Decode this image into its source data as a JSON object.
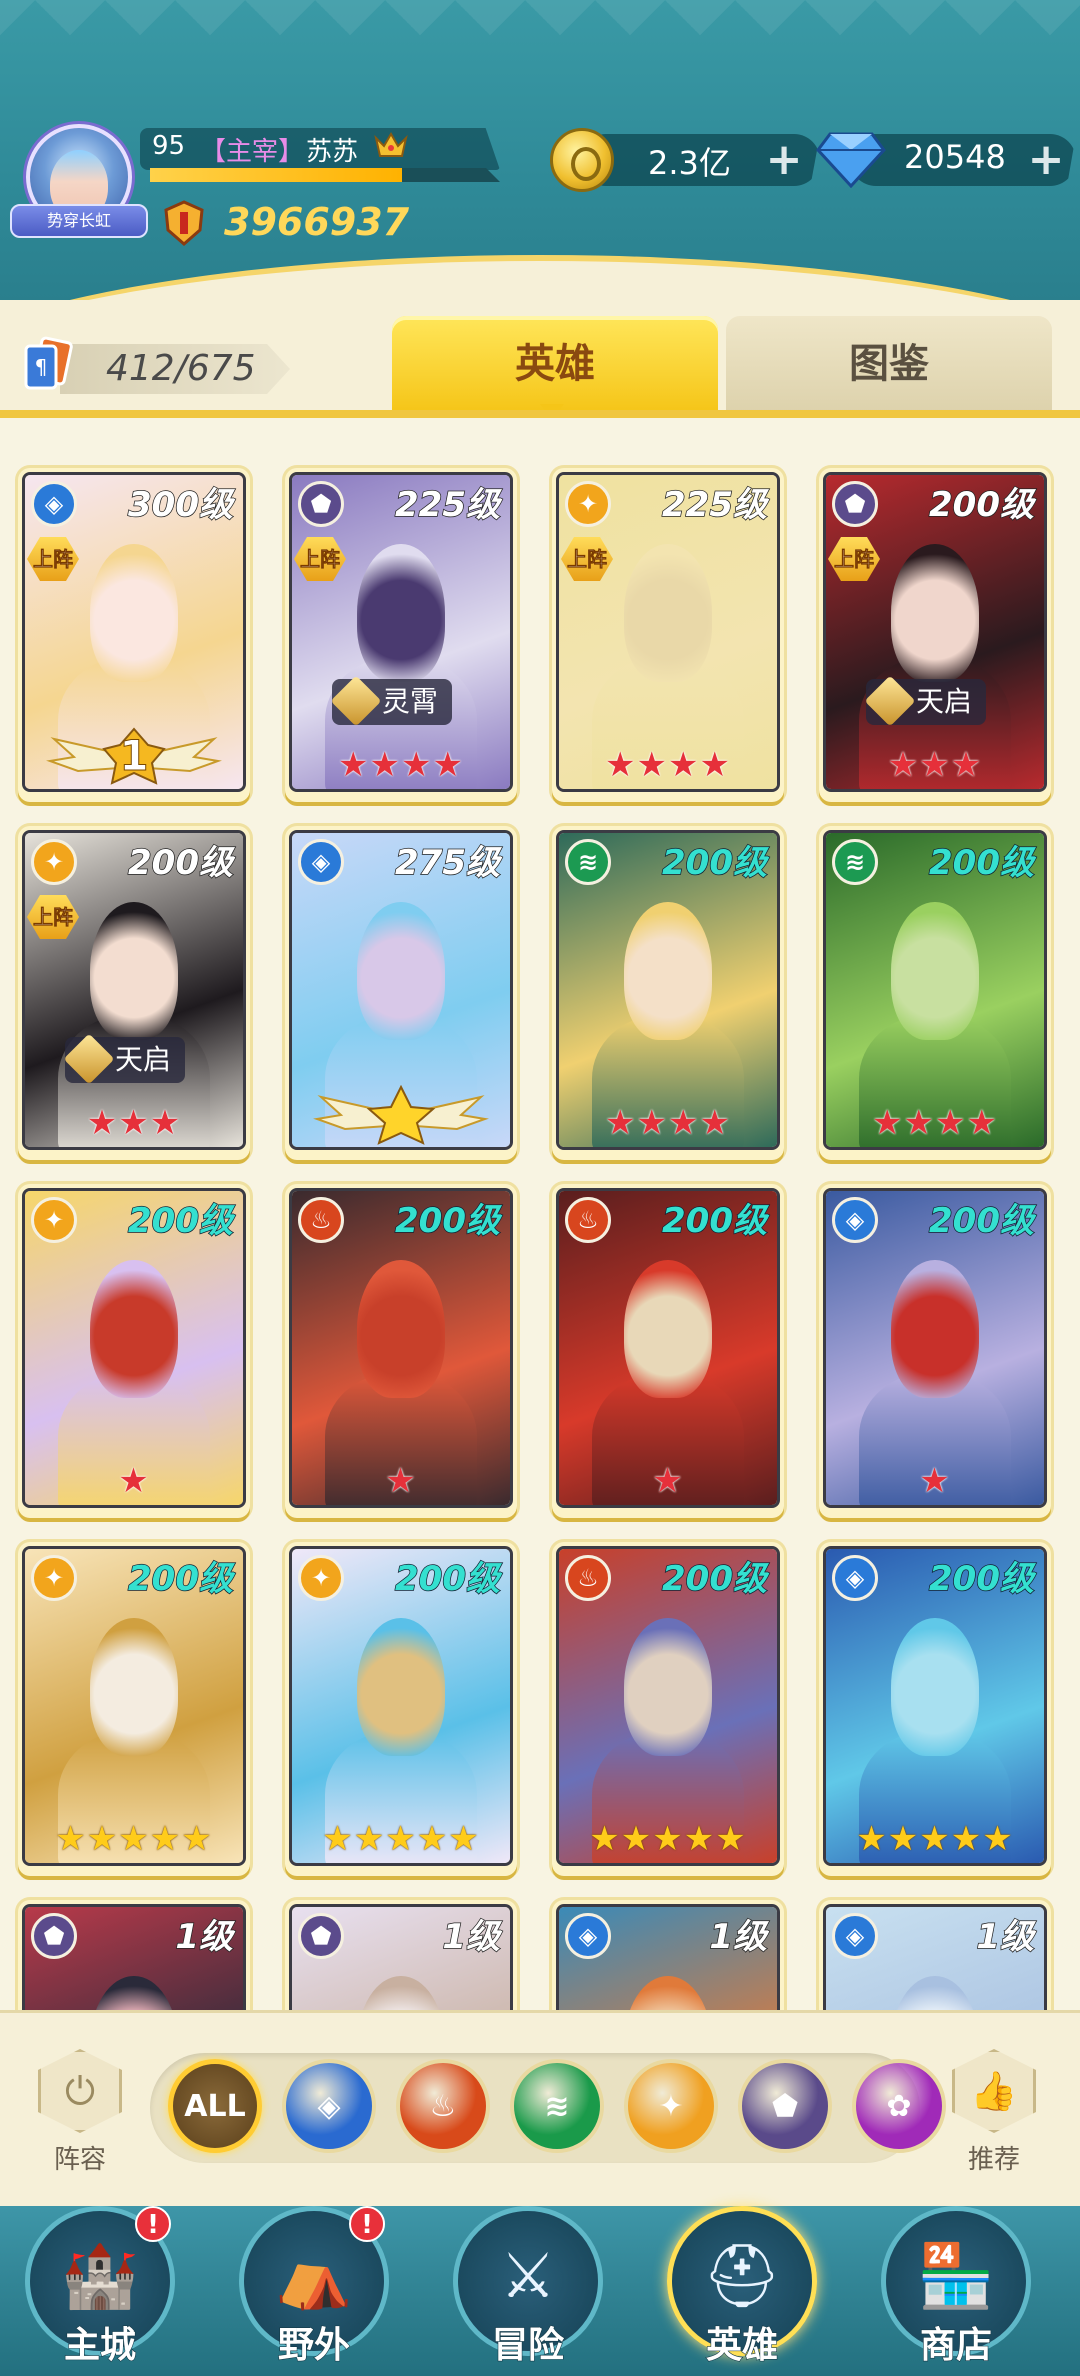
{
  "player": {
    "level": "95",
    "title": "【主宰】",
    "name": "苏苏",
    "avatar_ribbon": "势穿长虹",
    "exp_fraction": 0.72,
    "power": "3966937"
  },
  "resources": {
    "gold": "2.3亿",
    "diamonds": "20548"
  },
  "collection": {
    "count": "412/675"
  },
  "tabs": [
    {
      "label": "英雄",
      "active": true
    },
    {
      "label": "图鉴",
      "active": false
    }
  ],
  "deploy_label": "上阵",
  "heroes": [
    {
      "level": "300级",
      "element": "water",
      "deployed": true,
      "skin": "",
      "stars": 0,
      "star_color": "",
      "rank": "1",
      "palette": [
        "#f6e6f0",
        "#f5d690",
        "#fbe7e0"
      ]
    },
    {
      "level": "225级",
      "element": "dark",
      "deployed": true,
      "skin": "灵霄",
      "stars": 4,
      "star_color": "red",
      "rank": "",
      "palette": [
        "#8a7ac0",
        "#e0dcef",
        "#4a3a70"
      ]
    },
    {
      "level": "225级",
      "element": "light",
      "deployed": true,
      "skin": "",
      "stars": 4,
      "star_color": "red",
      "rank": "",
      "palette": [
        "#efe2a0",
        "#f3e4b0",
        "#e9d8a8"
      ]
    },
    {
      "level": "200级",
      "element": "dark",
      "deployed": true,
      "skin": "天启",
      "stars": 3,
      "star_color": "red",
      "rank": "",
      "palette": [
        "#b82a2e",
        "#2a1a1e",
        "#f0d6cc"
      ]
    },
    {
      "level": "200级",
      "element": "light",
      "deployed": true,
      "skin": "天启",
      "stars": 3,
      "star_color": "red",
      "rank": "",
      "palette": [
        "#e6e2da",
        "#1e1a1e",
        "#f3ddd0"
      ]
    },
    {
      "level": "275级",
      "element": "water",
      "deployed": false,
      "skin": "",
      "stars": 1,
      "star_color": "gold-badge",
      "rank": "",
      "palette": [
        "#c8d8f8",
        "#7fcdf0",
        "#d8c8e8"
      ]
    },
    {
      "level": "200级",
      "element": "wind",
      "deployed": false,
      "skin": "",
      "stars": 4,
      "star_color": "red",
      "rank": "",
      "palette": [
        "#2e6a5a",
        "#f0d070",
        "#f4e0c8"
      ]
    },
    {
      "level": "200级",
      "element": "wind",
      "deployed": false,
      "skin": "",
      "stars": 4,
      "star_color": "red",
      "rank": "",
      "palette": [
        "#2a6a2a",
        "#9ad060",
        "#c8e0a0"
      ]
    },
    {
      "level": "200级",
      "element": "light",
      "deployed": false,
      "skin": "",
      "stars": 1,
      "star_color": "red",
      "rank": "",
      "palette": [
        "#f6d66a",
        "#d8c0f0",
        "#c83a2a"
      ]
    },
    {
      "level": "200级",
      "element": "fire",
      "deployed": false,
      "skin": "",
      "stars": 1,
      "star_color": "red",
      "rank": "",
      "palette": [
        "#3a2a2e",
        "#e0583a",
        "#c8402a"
      ]
    },
    {
      "level": "200级",
      "element": "fire",
      "deployed": false,
      "skin": "",
      "stars": 1,
      "star_color": "red",
      "rank": "",
      "palette": [
        "#5a1e1e",
        "#d83a2a",
        "#e8d8b8"
      ]
    },
    {
      "level": "200级",
      "element": "water",
      "deployed": false,
      "skin": "",
      "stars": 1,
      "star_color": "red",
      "rank": "",
      "palette": [
        "#3a5aa0",
        "#b8b0e0",
        "#c8302a"
      ]
    },
    {
      "level": "200级",
      "element": "light",
      "deployed": false,
      "skin": "",
      "stars": 5,
      "star_color": "gold",
      "rank": "",
      "palette": [
        "#f8e4b8",
        "#d0a040",
        "#f4ece0"
      ]
    },
    {
      "level": "200级",
      "element": "light",
      "deployed": false,
      "skin": "",
      "stars": 5,
      "star_color": "gold",
      "rank": "",
      "palette": [
        "#f0e8f8",
        "#5ac0e8",
        "#e0c080"
      ]
    },
    {
      "level": "200级",
      "element": "fire",
      "deployed": false,
      "skin": "",
      "stars": 5,
      "star_color": "gold",
      "rank": "",
      "palette": [
        "#c8402a",
        "#6a70b8",
        "#e0d0c0"
      ]
    },
    {
      "level": "200级",
      "element": "water",
      "deployed": false,
      "skin": "",
      "stars": 5,
      "star_color": "gold",
      "rank": "",
      "palette": [
        "#2a5ab0",
        "#60c8e8",
        "#a8e0f0"
      ]
    },
    {
      "level": "1级",
      "element": "dark",
      "deployed": false,
      "skin": "",
      "stars": 0,
      "star_color": "",
      "rank": "",
      "palette": [
        "#b83a4a",
        "#2a2a3a",
        "#e8b0b8"
      ]
    },
    {
      "level": "1级",
      "element": "dark",
      "deployed": false,
      "skin": "",
      "stars": 0,
      "star_color": "",
      "rank": "",
      "palette": [
        "#e8e0f0",
        "#c8b0a0",
        "#f0e8e8"
      ]
    },
    {
      "level": "1级",
      "element": "water",
      "deployed": false,
      "skin": "",
      "stars": 0,
      "star_color": "",
      "rank": "",
      "palette": [
        "#3a8ab8",
        "#e07a3a",
        "#f0c8a0"
      ]
    },
    {
      "level": "1级",
      "element": "water",
      "deployed": false,
      "skin": "",
      "stars": 0,
      "star_color": "",
      "rank": "",
      "palette": [
        "#c8e0f0",
        "#a8c0e0",
        "#e8f0f8"
      ]
    }
  ],
  "filters": {
    "left_label": "阵容",
    "right_label": "推荐",
    "items": [
      {
        "name": "all",
        "label": "ALL",
        "color": "#6a4a20"
      },
      {
        "name": "water",
        "label": "",
        "color": "#2a6ad0"
      },
      {
        "name": "fire",
        "label": "",
        "color": "#d84a1a"
      },
      {
        "name": "wind",
        "label": "",
        "color": "#1a9a4a"
      },
      {
        "name": "light",
        "label": "",
        "color": "#f0a020"
      },
      {
        "name": "dark",
        "label": "",
        "color": "#5a4a8a"
      },
      {
        "name": "chaos",
        "label": "",
        "color": "#a02ab8"
      }
    ]
  },
  "element_colors": {
    "water": "#2a7ad8",
    "fire": "#d8461e",
    "wind": "#1c9a52",
    "light": "#f2a51c",
    "dark": "#5b4b8c"
  },
  "nav": [
    {
      "label": "主城",
      "alert": "!",
      "glyph": "🏰"
    },
    {
      "label": "野外",
      "alert": "!",
      "glyph": "⛺"
    },
    {
      "label": "冒险",
      "alert": "",
      "glyph": "⚔"
    },
    {
      "label": "英雄",
      "alert": "",
      "glyph": "⛑",
      "active": true
    },
    {
      "label": "商店",
      "alert": "",
      "glyph": "🏪"
    }
  ]
}
